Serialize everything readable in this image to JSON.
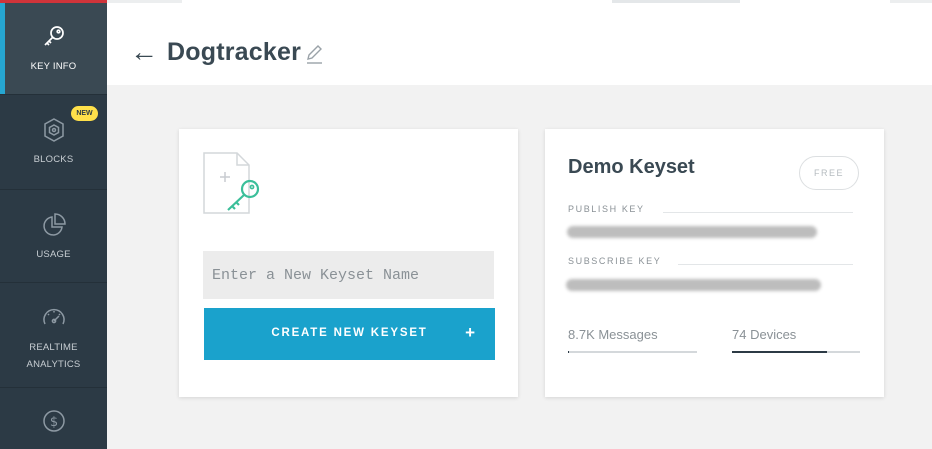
{
  "sidebar": {
    "items": [
      {
        "label": "KEY INFO",
        "icon": "key-icon"
      },
      {
        "label": "BLOCKS",
        "icon": "blocks-icon"
      },
      {
        "label": "USAGE",
        "icon": "pie-chart-icon"
      },
      {
        "label": "REALTIME\nANALYTICS",
        "icon": "speedometer-icon"
      },
      {
        "label": "",
        "icon": "dollar-icon"
      }
    ],
    "new_badge": "NEW"
  },
  "header": {
    "back_symbol": "←",
    "title": "Dogtracker"
  },
  "new_keyset": {
    "input_placeholder": "Enter a New Keyset Name",
    "input_value": "",
    "button_label": "CREATE NEW KEYSET",
    "button_plus": "+"
  },
  "keyset": {
    "title": "Demo Keyset",
    "plan_badge": "FREE",
    "publish_label": "PUBLISH KEY",
    "subscribe_label": "SUBSCRIBE KEY",
    "messages_label": "8.7K Messages",
    "messages_fill_pct": 1,
    "devices_label": "74 Devices",
    "devices_fill_pct": 74
  },
  "colors": {
    "sidebar_bg": "#2c3a45",
    "accent": "#1aa2cc",
    "new_badge": "#ffe04a",
    "key_icon_green": "#3bbf9a"
  }
}
